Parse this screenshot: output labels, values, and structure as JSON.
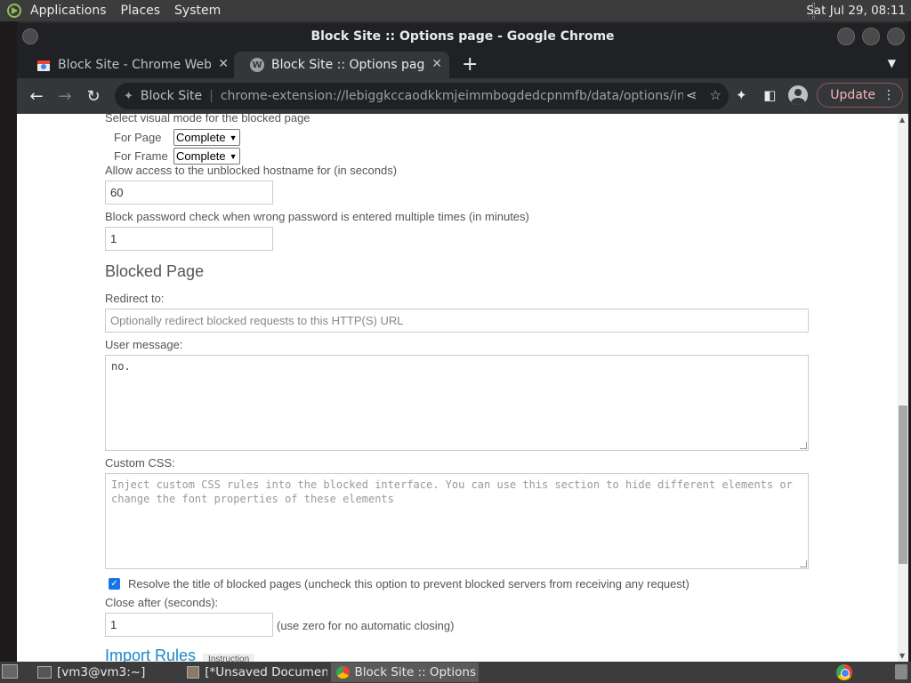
{
  "top_panel": {
    "menus": [
      "Applications",
      "Places",
      "System"
    ],
    "clock": "Sat Jul 29, 08:11"
  },
  "window": {
    "title": "Block Site :: Options page - Google Chrome"
  },
  "tabs": [
    {
      "title": "Block Site - Chrome Web Store",
      "close": "✕"
    },
    {
      "title": "Block Site :: Options page",
      "close": "✕",
      "favicon_letter": "W"
    }
  ],
  "toolbar": {
    "site_name": "Block Site",
    "url": "chrome-extension://lebiggkccaodkkmjeimmbogdedcpnmfb/data/options/index.html",
    "update_label": "Update"
  },
  "page": {
    "visual_mode_label": "Select visual mode for the blocked page",
    "for_page_label": "For Page",
    "for_page_value": "Complete",
    "for_frame_label": "For Frame",
    "for_frame_value": "Complete",
    "allow_access_label": "Allow access to the unblocked hostname for (in seconds)",
    "allow_access_value": "60",
    "block_password_label": "Block password check when wrong password is entered multiple times (in minutes)",
    "block_password_value": "1",
    "blocked_page_heading": "Blocked Page",
    "redirect_label": "Redirect to:",
    "redirect_placeholder": "Optionally redirect blocked requests to this HTTP(S) URL",
    "user_message_label": "User message:",
    "user_message_value": "no.",
    "custom_css_label": "Custom CSS:",
    "custom_css_placeholder": "Inject custom CSS rules into the blocked interface. You can use this section to hide different elements or change the font properties of these elements",
    "resolve_title_label": "Resolve the title of blocked pages (uncheck this option to prevent blocked servers from receiving any request)",
    "resolve_title_checked": true,
    "close_after_label": "Close after (seconds):",
    "close_after_value": "1",
    "close_after_hint": "(use zero for no automatic closing)",
    "import_rules_heading": "Import Rules",
    "instruction_label": "Instruction"
  },
  "taskbar": {
    "tasks": [
      {
        "label": "[vm3@vm3:~]"
      },
      {
        "label": "[*Unsaved Document..."
      },
      {
        "label": "Block Site :: Options ..."
      }
    ]
  }
}
